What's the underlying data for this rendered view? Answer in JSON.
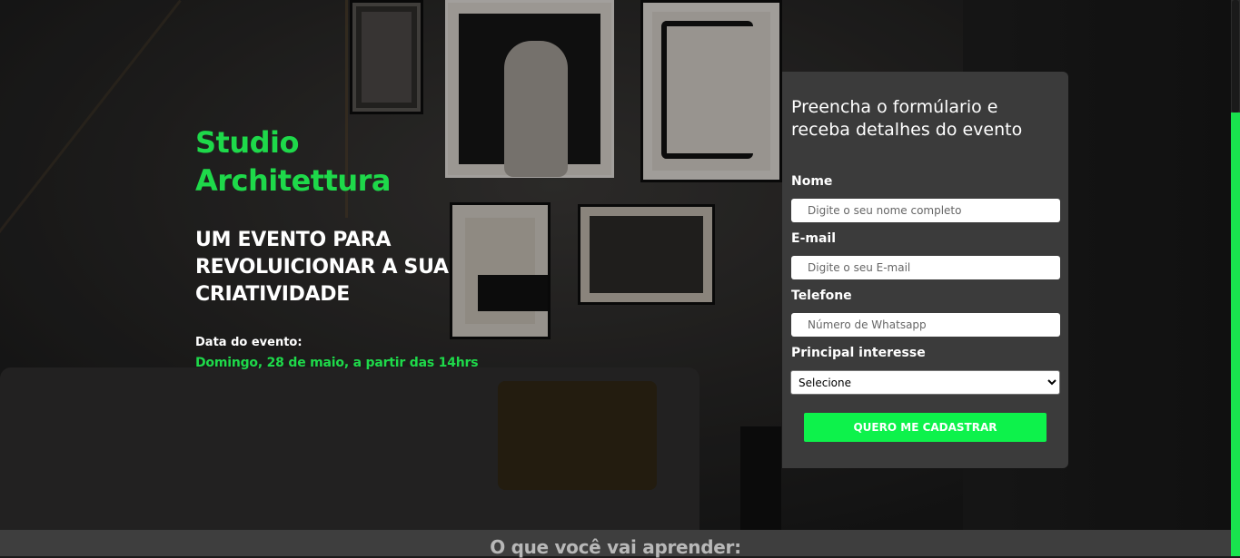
{
  "hero": {
    "brand": "Studio Architettura",
    "tagline": "UM EVENTO PARA REVOLUICIONAR A SUA CRIATIVIDADE",
    "date_label": "Data do evento:",
    "date_value": "Domingo, 28 de maio, a partir das 14hrs"
  },
  "form": {
    "title": "Preencha o formúlario e receba detalhes do evento",
    "name_label": "Nome",
    "name_placeholder": "Digite o seu nome completo",
    "email_label": "E-mail",
    "email_placeholder": "Digite o seu E-mail",
    "phone_label": "Telefone",
    "phone_placeholder": "Número de Whatsapp",
    "interest_label": "Principal interesse",
    "interest_selected": "Selecione",
    "submit_label": "QUERO ME CADASTRAR"
  },
  "learn": {
    "title": "O que você vai aprender:"
  },
  "colors": {
    "accent_green": "#0df24b",
    "brand_green": "#1ed94a",
    "card_bg": "#3b3b3b"
  }
}
